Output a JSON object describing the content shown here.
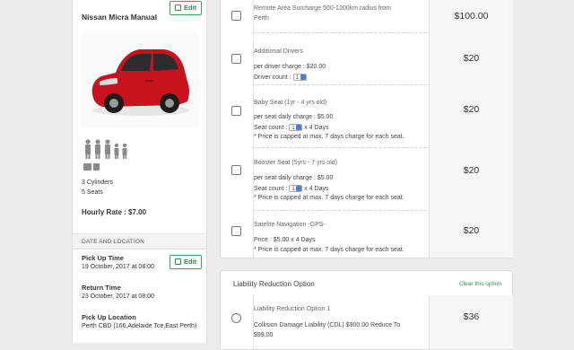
{
  "sidebar": {
    "car_title": "Nissan Micra Manual",
    "edit_label": "Edit",
    "cylinders": "3 Cylinders",
    "seats": "5 Seats",
    "hourly_rate": "Hourly Rate : $7.00",
    "date_location_header": "DATE AND LOCATION",
    "pickup_time_label": "Pick Up Time",
    "pickup_time_value": "19 October, 2017 at 08:00",
    "return_time_label": "Return Time",
    "return_time_value": "23 October, 2017 at 08:00",
    "pickup_location_label": "Pick Up Location",
    "pickup_location_value": "Perth CBD (166,Adelaide Tce,East Perth)"
  },
  "extras": [
    {
      "title_line1": "Remote Area Surcharge 500-1200km radius from",
      "title_line2": "Perth",
      "price": "$100.00"
    },
    {
      "title": "Additional Drivers",
      "line1": "per driver charge : $20.00",
      "line2_label": "Driver count :",
      "count": "1",
      "price": "$20"
    },
    {
      "title": "Baby Seat (1yr - 4 yrs old)",
      "line1": "per seat daily charge : $5.00",
      "line2_label": "Seat count :",
      "count": "1",
      "line2_suffix": "x 4 Days",
      "note": "* Price is capped at max. 7 days charge for each seat.",
      "price": "$20"
    },
    {
      "title": "Booster Seat (5yrs - 7 yrs old)",
      "line1": "per seat daily charge : $5.00",
      "line2_label": "Seat count :",
      "count": "1",
      "line2_suffix": "x 4 Days",
      "note": "* Price is capped at max. 7 days charge for each seat.",
      "price": "$20"
    },
    {
      "title": "Satelite Navigation -GPS-",
      "line1": "Price : $5.00 x 4 Days",
      "note": "* Price is capped at max. 7 days charge for each seat.",
      "price": "$20"
    }
  ],
  "liability": {
    "header": "Liability Reduction Option",
    "clear_label": "Clear this option",
    "option_title": "Liability Reduction Option 1",
    "option_line1": "Collision Damage Liability (CDL) $900.00 Reduce To",
    "option_line2": "$99.00",
    "price": "$36"
  },
  "colors": {
    "accent_green": "#2f8f4a",
    "car_red": "#c8121e",
    "select_blue": "#4a7fd6"
  }
}
